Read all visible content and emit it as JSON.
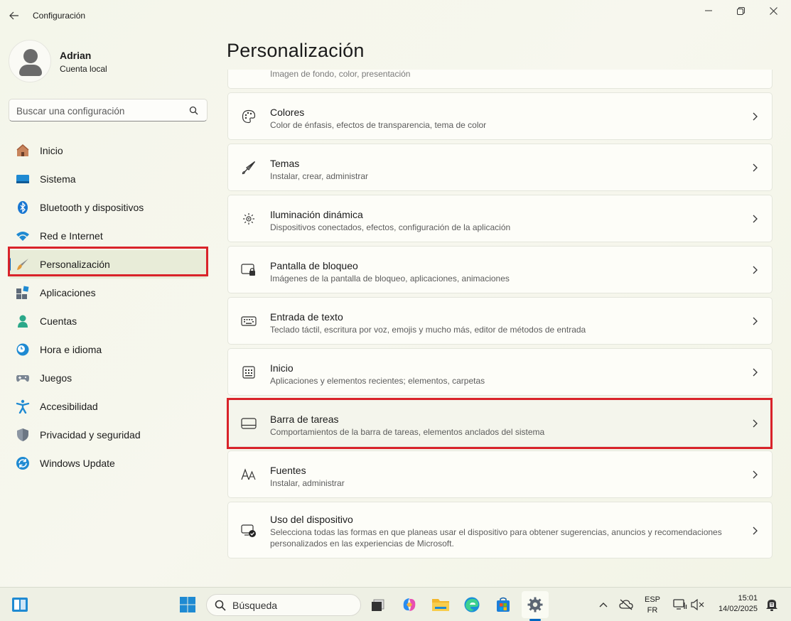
{
  "window": {
    "title": "Configuración"
  },
  "profile": {
    "name": "Adrian",
    "account_type": "Cuenta local"
  },
  "search": {
    "placeholder": "Buscar una configuración"
  },
  "sidebar": {
    "items": [
      {
        "label": "Inicio",
        "icon": "home-icon"
      },
      {
        "label": "Sistema",
        "icon": "system-icon"
      },
      {
        "label": "Bluetooth y dispositivos",
        "icon": "bluetooth-icon"
      },
      {
        "label": "Red e Internet",
        "icon": "wifi-icon"
      },
      {
        "label": "Personalización",
        "icon": "paintbrush-icon",
        "active": true
      },
      {
        "label": "Aplicaciones",
        "icon": "apps-icon"
      },
      {
        "label": "Cuentas",
        "icon": "accounts-icon"
      },
      {
        "label": "Hora e idioma",
        "icon": "time-language-icon"
      },
      {
        "label": "Juegos",
        "icon": "gamepad-icon"
      },
      {
        "label": "Accesibilidad",
        "icon": "accessibility-icon"
      },
      {
        "label": "Privacidad y seguridad",
        "icon": "shield-icon"
      },
      {
        "label": "Windows Update",
        "icon": "update-icon"
      }
    ]
  },
  "main": {
    "title": "Personalización",
    "partial_card_sub": "Imagen de fondo, color, presentación",
    "cards": [
      {
        "title": "Colores",
        "subtitle": "Color de énfasis, efectos de transparencia, tema de color",
        "icon": "palette-icon"
      },
      {
        "title": "Temas",
        "subtitle": "Instalar, crear, administrar",
        "icon": "brush-icon"
      },
      {
        "title": "Iluminación dinámica",
        "subtitle": "Dispositivos conectados, efectos, configuración de la aplicación",
        "icon": "dynamic-lighting-icon"
      },
      {
        "title": "Pantalla de bloqueo",
        "subtitle": "Imágenes de la pantalla de bloqueo, aplicaciones, animaciones",
        "icon": "lock-screen-icon"
      },
      {
        "title": "Entrada de texto",
        "subtitle": "Teclado táctil, escritura por voz, emojis y mucho más, editor de métodos de entrada",
        "icon": "keyboard-icon"
      },
      {
        "title": "Inicio",
        "subtitle": "Aplicaciones y elementos recientes; elementos, carpetas",
        "icon": "start-menu-icon"
      },
      {
        "title": "Barra de tareas",
        "subtitle": "Comportamientos de la barra de tareas, elementos anclados del sistema",
        "icon": "taskbar-icon",
        "highlighted": true
      },
      {
        "title": "Fuentes",
        "subtitle": "Instalar, administrar",
        "icon": "fonts-icon"
      },
      {
        "title": "Uso del dispositivo",
        "subtitle": "Selecciona todas las formas en que planeas usar el dispositivo para obtener sugerencias, anuncios y recomendaciones personalizados en las experiencias de Microsoft.",
        "icon": "device-usage-icon"
      }
    ]
  },
  "taskbar": {
    "search_label": "Búsqueda",
    "language_top": "ESP",
    "language_bottom": "FR",
    "time": "15:01",
    "date": "14/02/2025"
  },
  "colors": {
    "accent": "#0067c0",
    "highlight_box": "#d9232a"
  }
}
